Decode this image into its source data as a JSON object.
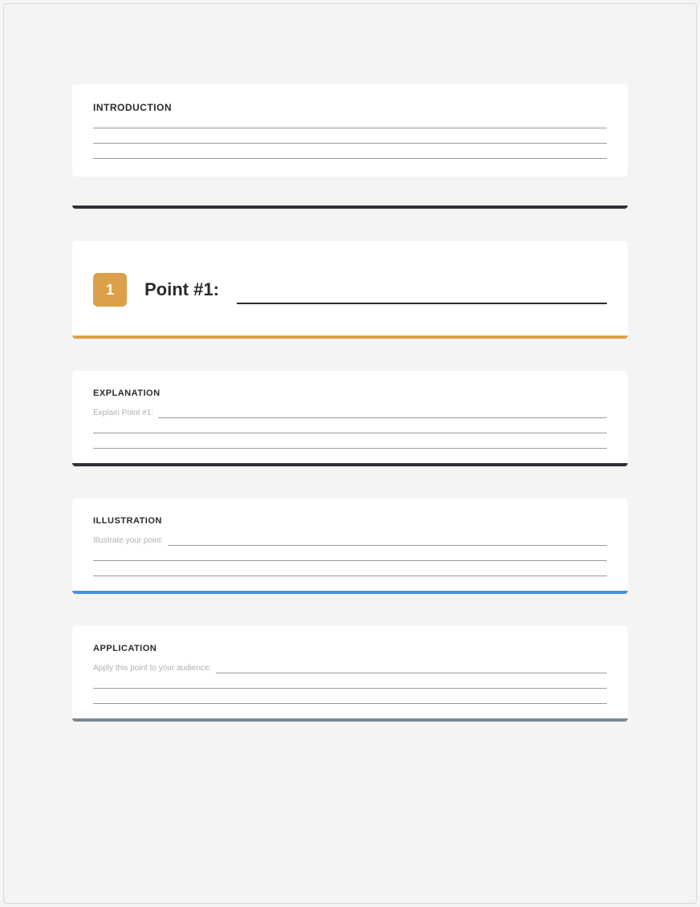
{
  "introduction": {
    "heading": "INTRODUCTION",
    "barColor": "#2f3338"
  },
  "point": {
    "badge": "1",
    "label": "Point #1:",
    "barColor": "#dca04a"
  },
  "explanation": {
    "heading": "EXPLANATION",
    "hint": "Explain Point #1:",
    "barColor": "#2f3338"
  },
  "illustration": {
    "heading": "ILLUSTRATION",
    "hint": "Illustrate your point:",
    "barColor": "#4a90e2"
  },
  "application": {
    "heading": "APPLICATION",
    "hint": "Apply this point to your audience:",
    "barColor": "#7a8794"
  }
}
